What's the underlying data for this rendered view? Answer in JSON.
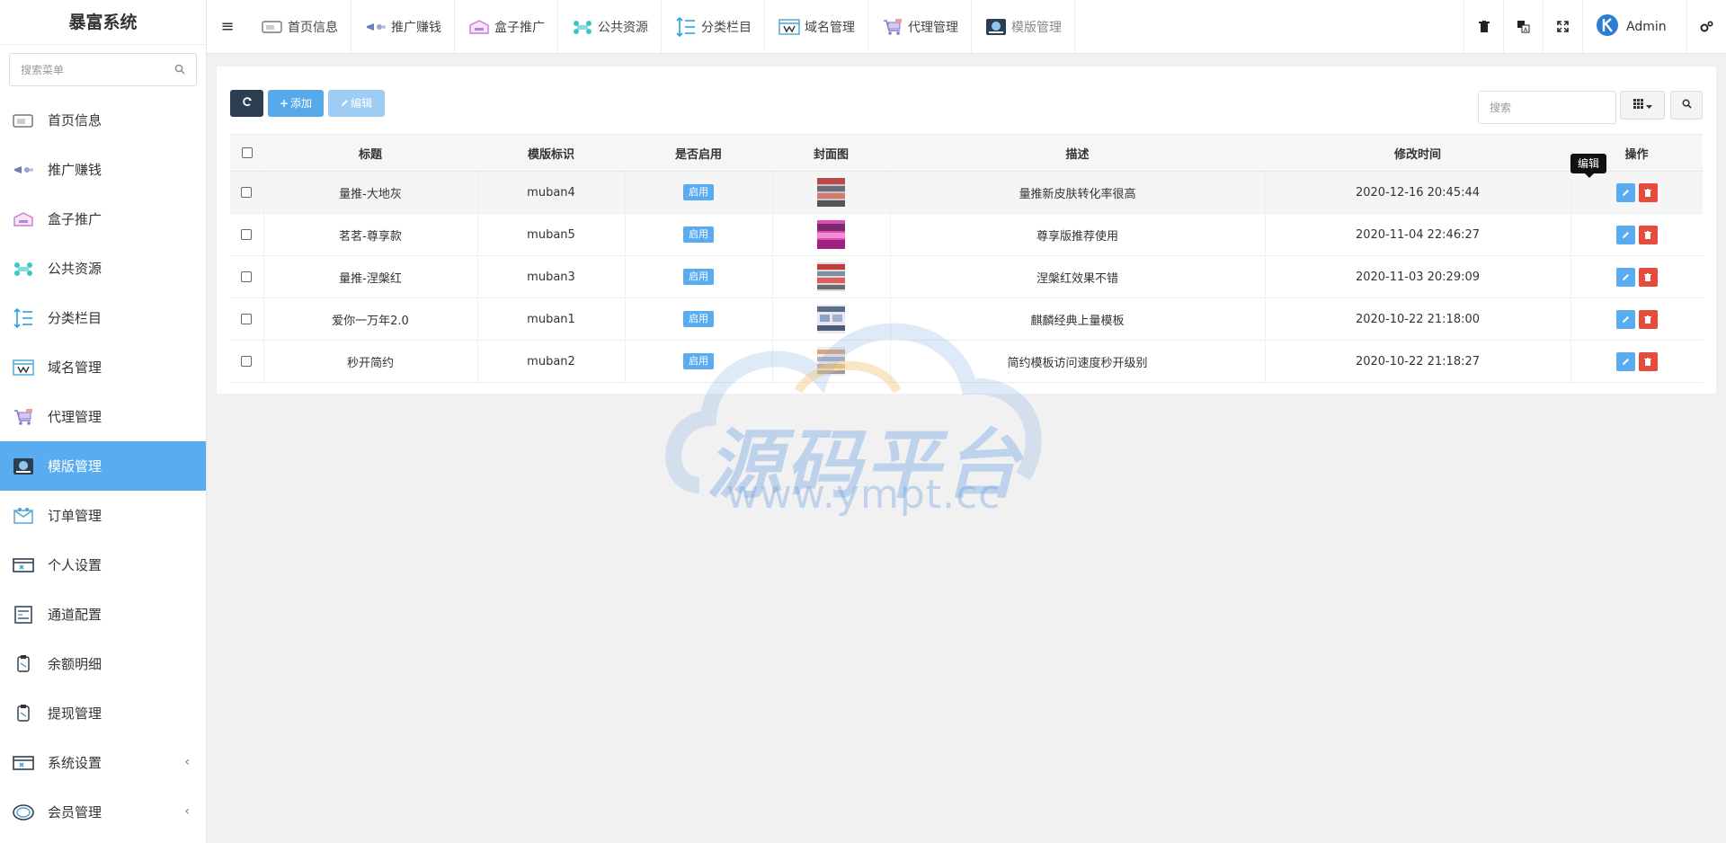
{
  "app": {
    "title": "暴富系统"
  },
  "sidebar": {
    "search_placeholder": "搜索菜单",
    "items": [
      {
        "label": "首页信息",
        "icon": "home-info-icon",
        "active": false
      },
      {
        "label": "推广赚钱",
        "icon": "promote-icon",
        "active": false
      },
      {
        "label": "盒子推广",
        "icon": "box-icon",
        "active": false
      },
      {
        "label": "公共资源",
        "icon": "resource-icon",
        "active": false
      },
      {
        "label": "分类栏目",
        "icon": "category-icon",
        "active": false
      },
      {
        "label": "域名管理",
        "icon": "domain-icon",
        "active": false
      },
      {
        "label": "代理管理",
        "icon": "agent-icon",
        "active": false
      },
      {
        "label": "模版管理",
        "icon": "template-icon",
        "active": true
      },
      {
        "label": "订单管理",
        "icon": "order-icon",
        "active": false
      },
      {
        "label": "个人设置",
        "icon": "profile-icon",
        "active": false
      },
      {
        "label": "通道配置",
        "icon": "channel-icon",
        "active": false
      },
      {
        "label": "余额明细",
        "icon": "balance-icon",
        "active": false
      },
      {
        "label": "提现管理",
        "icon": "withdraw-icon",
        "active": false
      },
      {
        "label": "系统设置",
        "icon": "system-icon",
        "active": false,
        "has_children": true
      },
      {
        "label": "会员管理",
        "icon": "member-icon",
        "active": false,
        "has_children": true
      }
    ]
  },
  "header": {
    "nav": [
      {
        "label": "首页信息"
      },
      {
        "label": "推广赚钱"
      },
      {
        "label": "盒子推广"
      },
      {
        "label": "公共资源"
      },
      {
        "label": "分类栏目"
      },
      {
        "label": "域名管理"
      },
      {
        "label": "代理管理"
      },
      {
        "label": "模版管理"
      }
    ],
    "user": "Admin"
  },
  "toolbar": {
    "add_label": "添加",
    "edit_label": "编辑",
    "search_placeholder": "搜索"
  },
  "table": {
    "columns": [
      "标题",
      "模版标识",
      "是否启用",
      "封面图",
      "描述",
      "修改时间",
      "操作"
    ],
    "rows": [
      {
        "title": "量推-大地灰",
        "key": "muban4",
        "status": "启用",
        "desc": "量推新皮肤转化率很高",
        "time": "2020-12-16 20:45:44"
      },
      {
        "title": "茗茗-尊享款",
        "key": "muban5",
        "status": "启用",
        "desc": "尊享版推荐使用",
        "time": "2020-11-04 22:46:27"
      },
      {
        "title": "量推-涅槃红",
        "key": "muban3",
        "status": "启用",
        "desc": "涅槃红效果不错",
        "time": "2020-11-03 20:29:09"
      },
      {
        "title": "爱你一万年2.0",
        "key": "muban1",
        "status": "启用",
        "desc": "麒麟经典上量模板",
        "time": "2020-10-22 21:18:00"
      },
      {
        "title": "秒开简约",
        "key": "muban2",
        "status": "启用",
        "desc": "简约模板访问速度秒开级别",
        "time": "2020-10-22 21:18:27"
      }
    ],
    "tooltip": "编辑"
  },
  "watermark": {
    "text": "源码平台",
    "url": "www.ympt.cc"
  },
  "colors": {
    "accent": "#5aacf1",
    "danger": "#e54c3c",
    "dark": "#2c3e50"
  }
}
